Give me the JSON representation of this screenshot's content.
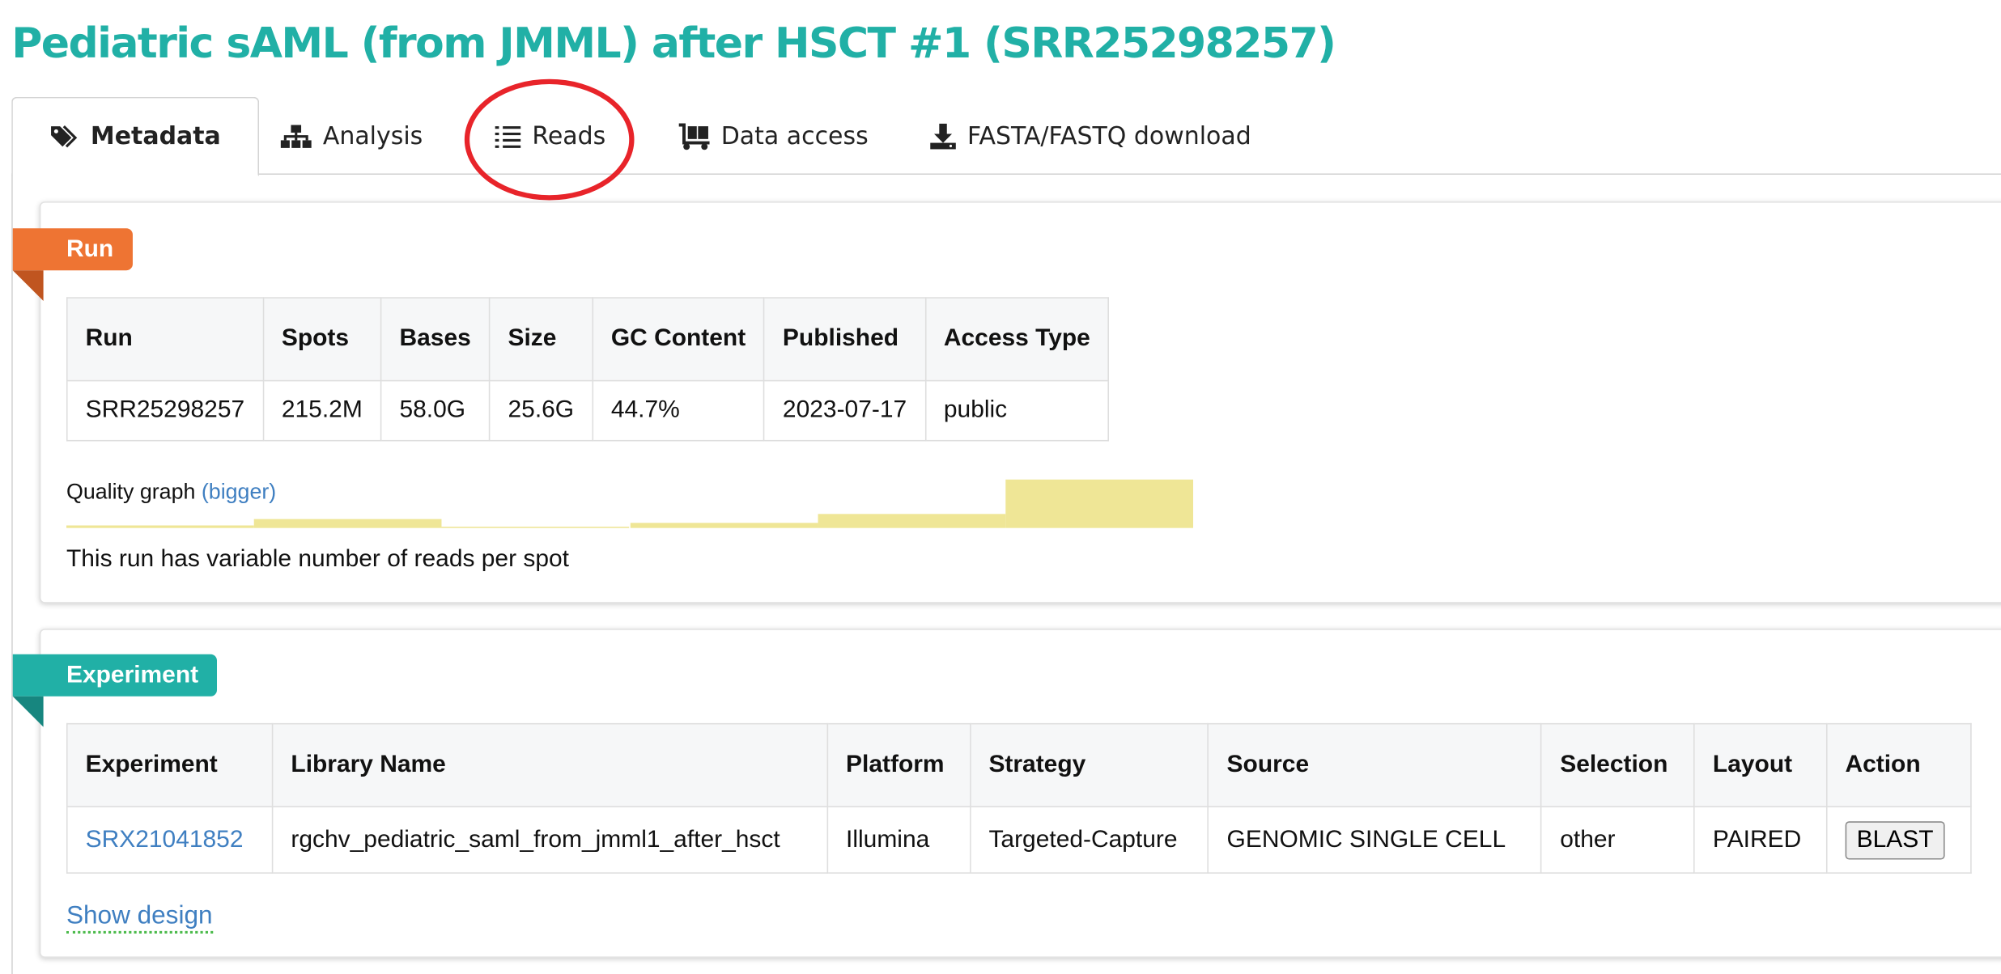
{
  "page_title": "Pediatric sAML (from JMML) after HSCT #1 (SRR25298257)",
  "tabs": [
    {
      "label": "Metadata",
      "icon": "tags-icon",
      "active": true
    },
    {
      "label": "Analysis",
      "icon": "sitemap-icon",
      "active": false
    },
    {
      "label": "Reads",
      "icon": "list-icon",
      "active": false
    },
    {
      "label": "Data access",
      "icon": "dolly-icon",
      "active": false
    },
    {
      "label": "FASTA/FASTQ download",
      "icon": "download-icon",
      "active": false
    }
  ],
  "annotation": {
    "circled_tab": "Reads",
    "color": "#e8242a"
  },
  "run": {
    "ribbon": "Run",
    "ribbon_color": "#ee7433",
    "headers": [
      "Run",
      "Spots",
      "Bases",
      "Size",
      "GC Content",
      "Published",
      "Access Type"
    ],
    "row": [
      "SRR25298257",
      "215.2M",
      "58.0G",
      "25.6G",
      "44.7%",
      "2023-07-17",
      "public"
    ],
    "quality_label": "Quality graph",
    "quality_link": "(bigger)",
    "quality_levels": [
      0.05,
      0.18,
      0.03,
      0.1,
      0.3,
      1.0
    ],
    "note": "This run has variable number of reads per spot"
  },
  "experiment": {
    "ribbon": "Experiment",
    "ribbon_color": "#21b0a6",
    "headers": [
      "Experiment",
      "Library Name",
      "Platform",
      "Strategy",
      "Source",
      "Selection",
      "Layout",
      "Action"
    ],
    "row": {
      "experiment": "SRX21041852",
      "library_name": "rgchv_pediatric_saml_from_jmml1_after_hsct",
      "platform": "Illumina",
      "strategy": "Targeted-Capture",
      "source": "GENOMIC SINGLE CELL",
      "selection": "other",
      "layout": "PAIRED",
      "action": "BLAST"
    },
    "show_design": "Show design"
  }
}
